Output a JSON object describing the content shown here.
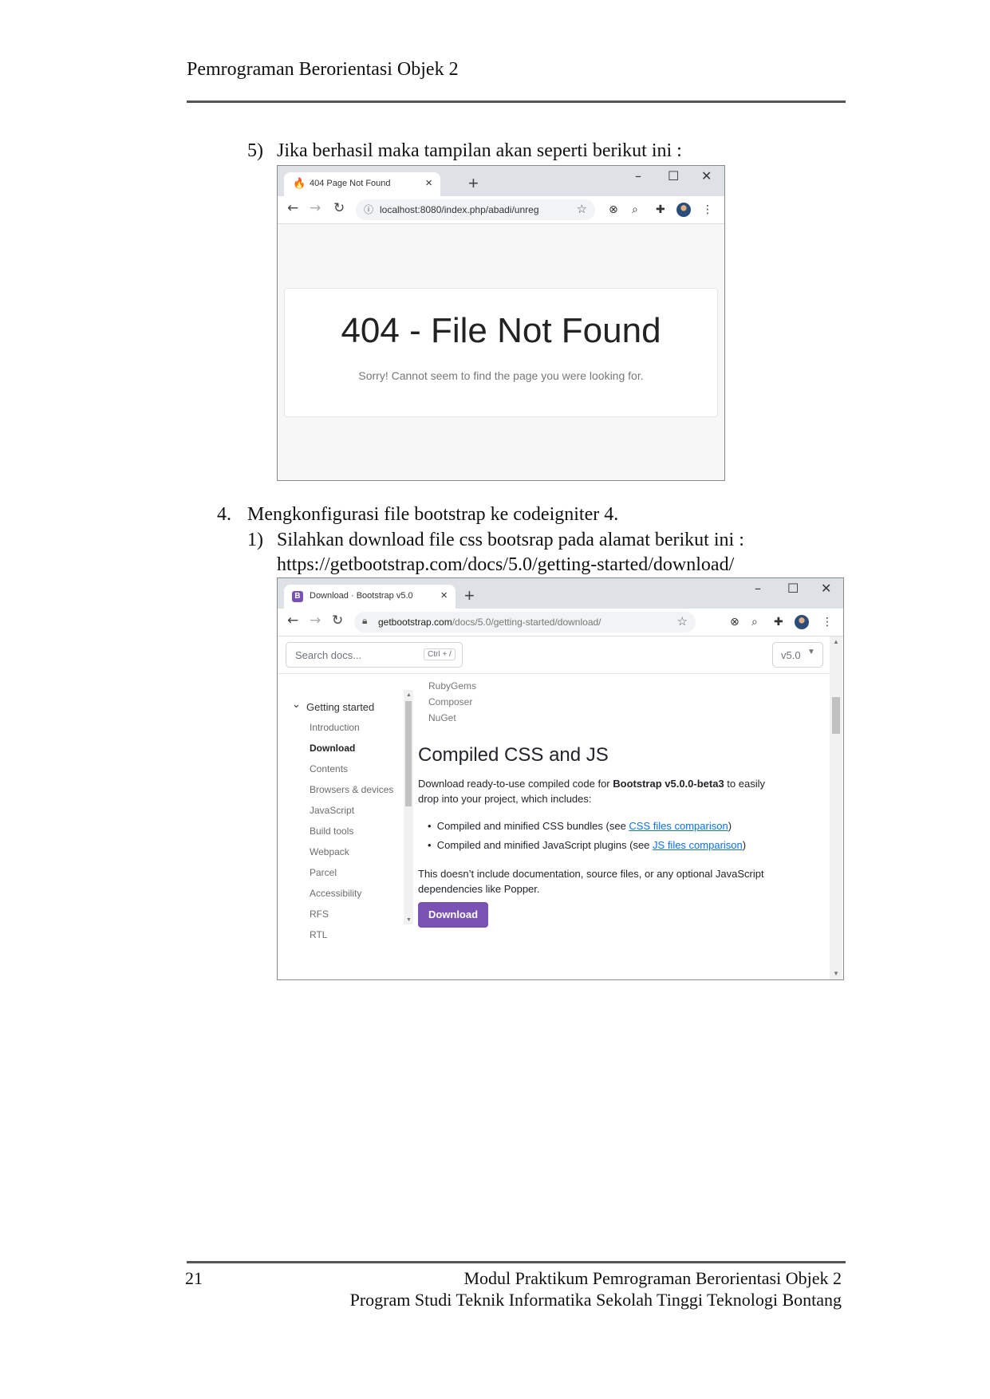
{
  "header": {
    "title": "Pemrograman Berorientasi Objek 2"
  },
  "steps": {
    "s5": {
      "num": "5)",
      "text": "Jika berhasil maka tampilan akan seperti berikut ini :"
    },
    "s4": {
      "num": "4.",
      "text": "Mengkonfigurasi file bootstrap ke codeigniter 4."
    },
    "s1": {
      "num": "1)",
      "text": "Silahkan download file css bootsrap pada alamat berikut ini :",
      "url": "https://getbootstrap.com/docs/5.0/getting-started/download/"
    }
  },
  "browser1": {
    "tab_title": "404 Page Not Found",
    "tab_icon": "fire-icon",
    "url": "localhost:8080/index.php/abadi/unreg",
    "page": {
      "heading": "404 - File Not Found",
      "message": "Sorry! Cannot seem to find the page you were looking for."
    }
  },
  "browser2": {
    "tab_title": "Download · Bootstrap v5.0",
    "tab_icon": "bootstrap-icon",
    "url_host": "getbootstrap.com",
    "url_path": "/docs/5.0/getting-started/download/",
    "search_placeholder": "Search docs...",
    "search_shortcut": "Ctrl + /",
    "version": "v5.0",
    "sidebar": {
      "section": "Getting started",
      "items": [
        "Introduction",
        "Download",
        "Contents",
        "Browsers & devices",
        "JavaScript",
        "Build tools",
        "Webpack",
        "Parcel",
        "Accessibility",
        "RFS",
        "RTL"
      ],
      "active": "Download"
    },
    "content": {
      "top_links": [
        "RubyGems",
        "Composer",
        "NuGet"
      ],
      "heading": "Compiled CSS and JS",
      "intro_pre": "Download ready-to-use compiled code for ",
      "intro_bold": "Bootstrap v5.0.0-beta3",
      "intro_post": " to easily drop into your project, which includes:",
      "bullet1_pre": "Compiled and minified CSS bundles (see ",
      "bullet1_link": "CSS files comparison",
      "bullet1_post": ")",
      "bullet2_pre": "Compiled and minified JavaScript plugins (see ",
      "bullet2_link": "JS files comparison",
      "bullet2_post": ")",
      "note": "This doesn’t include documentation, source files, or any optional JavaScript dependencies like Popper.",
      "button": "Download",
      "brand_color": "#7952b3"
    }
  },
  "footer": {
    "page_number": "21",
    "line1": "Modul Praktikum Pemrograman Berorientasi Objek 2",
    "line2": "Program Studi Teknik Informatika Sekolah Tinggi Teknologi Bontang"
  }
}
